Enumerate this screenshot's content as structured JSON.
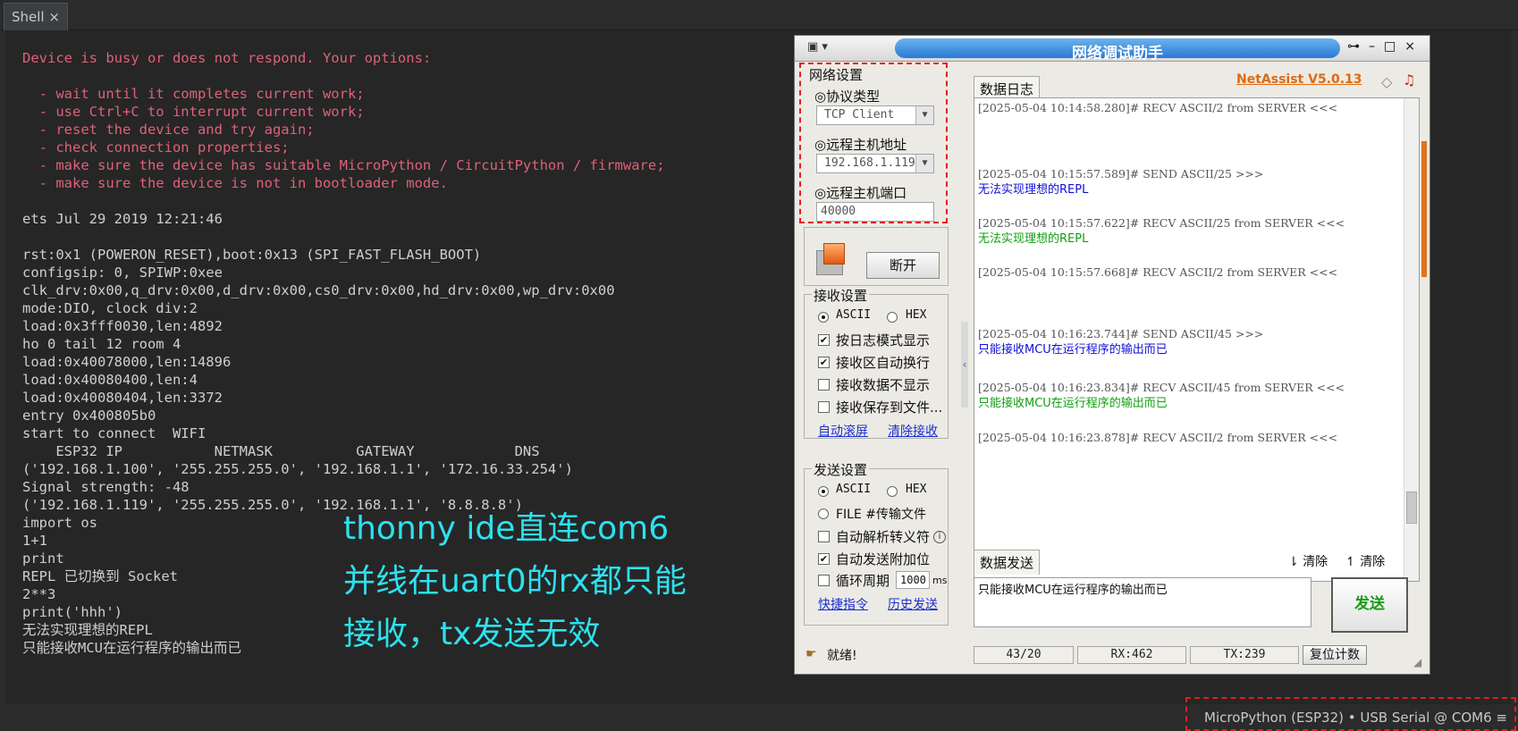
{
  "tab": {
    "label": "Shell",
    "close": "×"
  },
  "shell": {
    "error_lines": [
      "Device is busy or does not respond. Your options:",
      "",
      "  - wait until it completes current work;",
      "  - use Ctrl+C to interrupt current work;",
      "  - reset the device and try again;",
      "  - check connection properties;",
      "  - make sure the device has suitable MicroPython / CircuitPython / firmware;",
      "  - make sure the device is not in bootloader mode."
    ],
    "boot_lines": [
      "",
      "ets Jul 29 2019 12:21:46",
      "",
      "rst:0x1 (POWERON_RESET),boot:0x13 (SPI_FAST_FLASH_BOOT)",
      "configsip: 0, SPIWP:0xee",
      "clk_drv:0x00,q_drv:0x00,d_drv:0x00,cs0_drv:0x00,hd_drv:0x00,wp_drv:0x00",
      "mode:DIO, clock div:2",
      "load:0x3fff0030,len:4892",
      "ho 0 tail 12 room 4",
      "load:0x40078000,len:14896",
      "load:0x40080400,len:4",
      "load:0x40080404,len:3372",
      "entry 0x400805b0",
      "start to connect  WIFI",
      "    ESP32 IP           NETMASK          GATEWAY            DNS",
      "('192.168.1.100', '255.255.255.0', '192.168.1.1', '172.16.33.254')",
      "Signal strength: -48",
      "('192.168.1.119', '255.255.255.0', '192.168.1.1', '8.8.8.8')",
      "import os",
      "1+1",
      "print",
      "REPL 已切换到 Socket",
      "2**3",
      "print('hhh')",
      "无法实现理想的REPL",
      "只能接收MCU在运行程序的输出而已"
    ]
  },
  "annotation": {
    "line1": "thonny ide直连com6",
    "line2": "并线在uart0的rx都只能",
    "line3": "接收，tx发送无效"
  },
  "status_bar": {
    "text": "MicroPython (ESP32)  •  USB Serial @ COM6  ≡"
  },
  "netassist": {
    "title": "网络调试助手",
    "version": "NetAssist V5.0.13",
    "net_settings": {
      "label": "网络设置",
      "protocol_label": "◎协议类型",
      "protocol_value": "TCP Client",
      "host_label": "◎远程主机地址",
      "host_value": "192.168.1.119",
      "port_label": "◎远程主机端口",
      "port_value": "40000",
      "disconnect_label": "断开"
    },
    "recv_settings": {
      "label": "接收设置",
      "ascii": "ASCII",
      "hex": "HEX",
      "opt_log_mode": "按日志模式显示",
      "opt_auto_wrap": "接收区自动换行",
      "opt_no_display": "接收数据不显示",
      "opt_save_file": "接收保存到文件...",
      "link_auto_scroll": "自动滚屏",
      "link_clear_recv": "清除接收"
    },
    "send_settings": {
      "label": "发送设置",
      "ascii": "ASCII",
      "hex": "HEX",
      "file_label": "FILE #传输文件",
      "opt_escape": "自动解析转义符",
      "opt_append": "自动发送附加位",
      "opt_cycle": "循环周期",
      "cycle_value": "1000",
      "cycle_unit": "ms",
      "link_quick": "快捷指令",
      "link_history": "历史发送"
    },
    "log_tab": "数据日志",
    "log_entries": [
      {
        "header": "[2025-05-04 10:14:58.280]# RECV ASCII/2 from SERVER <<<",
        "message": "",
        "color": ""
      },
      {
        "header": "[2025-05-04 10:15:57.589]# SEND ASCII/25 >>>",
        "message": "无法实现理想的REPL",
        "color": "blue"
      },
      {
        "header": "[2025-05-04 10:15:57.622]# RECV ASCII/25 from SERVER <<<",
        "message": "无法实现理想的REPL",
        "color": "green"
      },
      {
        "header": "[2025-05-04 10:15:57.668]# RECV ASCII/2 from SERVER <<<",
        "message": "",
        "color": ""
      },
      {
        "header": "[2025-05-04 10:16:23.744]# SEND ASCII/45 >>>",
        "message": "只能接收MCU在运行程序的输出而已",
        "color": "blue"
      },
      {
        "header": "[2025-05-04 10:16:23.834]# RECV ASCII/45 from SERVER <<<",
        "message": "只能接收MCU在运行程序的输出而已",
        "color": "green"
      },
      {
        "header": "[2025-05-04 10:16:23.878]# RECV ASCII/2 from SERVER <<<",
        "message": "",
        "color": ""
      }
    ],
    "send_tab": "数据发送",
    "clear_left": "清除",
    "clear_right": "清除",
    "send_text": "只能接收MCU在运行程序的输出而已",
    "send_button": "发送",
    "status": {
      "ready": "就绪!",
      "counter": "43/20",
      "rx": "RX:462",
      "tx": "TX:239",
      "reset_count": "复位计数"
    }
  }
}
